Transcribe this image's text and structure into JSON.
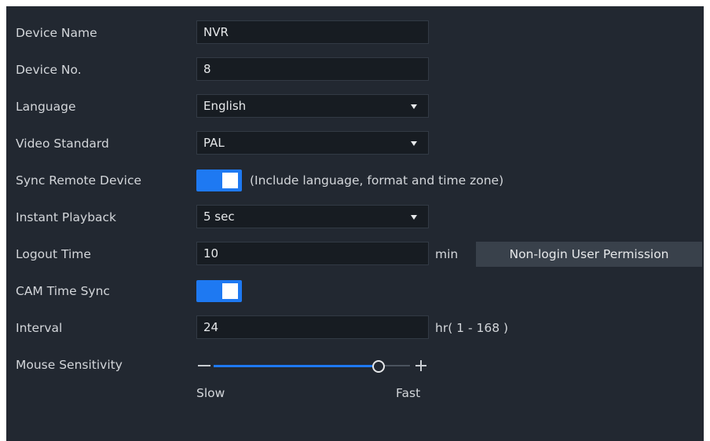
{
  "rows": {
    "device_name": {
      "label": "Device Name",
      "value": "NVR"
    },
    "device_no": {
      "label": "Device No.",
      "value": "8"
    },
    "language": {
      "label": "Language",
      "value": "English"
    },
    "video_standard": {
      "label": "Video Standard",
      "value": "PAL"
    },
    "sync_remote": {
      "label": "Sync Remote Device",
      "enabled": true,
      "note": "(Include language, format and time zone)"
    },
    "instant_playback": {
      "label": "Instant Playback",
      "value": "5 sec"
    },
    "logout_time": {
      "label": "Logout Time",
      "value": "10",
      "unit": "min",
      "button": "Non-login User Permission"
    },
    "cam_time_sync": {
      "label": "CAM Time Sync",
      "enabled": true
    },
    "interval": {
      "label": "Interval",
      "value": "24",
      "unit": "hr( 1 - 168 )"
    },
    "mouse_sensitivity": {
      "label": "Mouse Sensitivity",
      "value_fraction": 0.83,
      "min_label": "Slow",
      "max_label": "Fast"
    }
  },
  "colors": {
    "background": "#222831",
    "accent": "#1e79f2",
    "field": "#171c22",
    "button": "#39414b"
  },
  "icons": {
    "dropdown": "caret-down-icon",
    "minus": "minus-icon",
    "plus": "plus-icon"
  }
}
